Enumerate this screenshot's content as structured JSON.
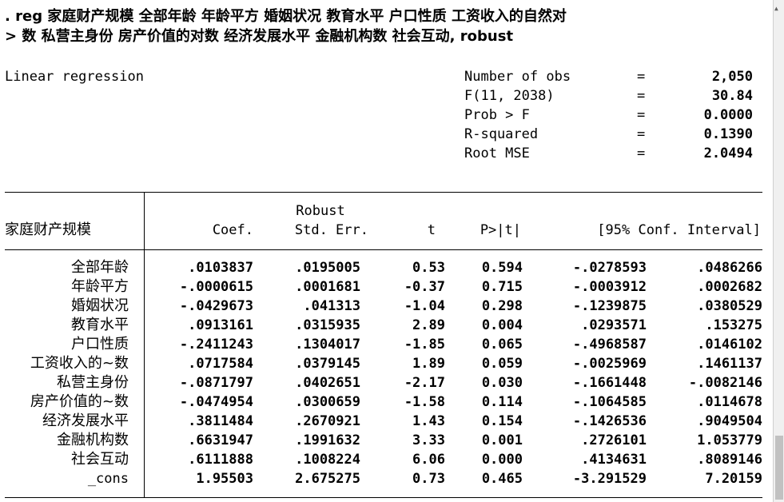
{
  "command": {
    "line1": ". reg 家庭财产规模 全部年龄 年龄平方 婚姻状况 教育水平 户口性质 工资收入的自然对",
    "line2": "> 数 私营主身份 房产价值的对数 经济发展水平 金融机构数 社会互动, robust"
  },
  "model": {
    "title": "Linear regression",
    "stats": [
      {
        "label": "Number of obs",
        "eq": "=",
        "value": "2,050"
      },
      {
        "label": "F(11, 2038)",
        "eq": "=",
        "value": "30.84"
      },
      {
        "label": "Prob > F",
        "eq": "=",
        "value": "0.0000"
      },
      {
        "label": "R-squared",
        "eq": "=",
        "value": "0.1390"
      },
      {
        "label": "Root MSE",
        "eq": "=",
        "value": "2.0494"
      }
    ]
  },
  "table": {
    "depvar": "家庭财产规模",
    "robust_label": "Robust",
    "headers": [
      "Coef.",
      "Std. Err.",
      "t",
      "P>|t|",
      "[95% Conf. Interval]"
    ],
    "rows": [
      {
        "name": "全部年龄",
        "coef": ".0103837",
        "se": ".0195005",
        "t": "0.53",
        "p": "0.594",
        "lo": "-.0278593",
        "hi": ".0486266"
      },
      {
        "name": "年龄平方",
        "coef": "-.0000615",
        "se": ".0001681",
        "t": "-0.37",
        "p": "0.715",
        "lo": "-.0003912",
        "hi": ".0002682"
      },
      {
        "name": "婚姻状况",
        "coef": "-.0429673",
        "se": ".041313",
        "t": "-1.04",
        "p": "0.298",
        "lo": "-.1239875",
        "hi": ".0380529"
      },
      {
        "name": "教育水平",
        "coef": ".0913161",
        "se": ".0315935",
        "t": "2.89",
        "p": "0.004",
        "lo": ".0293571",
        "hi": ".153275"
      },
      {
        "name": "户口性质",
        "coef": "-.2411243",
        "se": ".1304017",
        "t": "-1.85",
        "p": "0.065",
        "lo": "-.4968587",
        "hi": ".0146102"
      },
      {
        "name": "工资收入的~数",
        "coef": ".0717584",
        "se": ".0379145",
        "t": "1.89",
        "p": "0.059",
        "lo": "-.0025969",
        "hi": ".1461137"
      },
      {
        "name": "私营主身份",
        "coef": "-.0871797",
        "se": ".0402651",
        "t": "-2.17",
        "p": "0.030",
        "lo": "-.1661448",
        "hi": "-.0082146"
      },
      {
        "name": "房产价值的~数",
        "coef": "-.0474954",
        "se": ".0300659",
        "t": "-1.58",
        "p": "0.114",
        "lo": "-.1064585",
        "hi": ".0114678"
      },
      {
        "name": "经济发展水平",
        "coef": ".3811484",
        "se": ".2670921",
        "t": "1.43",
        "p": "0.154",
        "lo": "-.1426536",
        "hi": ".9049504"
      },
      {
        "name": "金融机构数",
        "coef": ".6631947",
        "se": ".1991632",
        "t": "3.33",
        "p": "0.001",
        "lo": ".2726101",
        "hi": "1.053779"
      },
      {
        "name": "社会互动",
        "coef": ".6111888",
        "se": ".1008224",
        "t": "6.06",
        "p": "0.000",
        "lo": ".4134631",
        "hi": ".8089146"
      },
      {
        "name": "_cons",
        "coef": "1.95503",
        "se": "2.675275",
        "t": "0.73",
        "p": "0.465",
        "lo": "-3.291529",
        "hi": "7.20159"
      }
    ]
  }
}
